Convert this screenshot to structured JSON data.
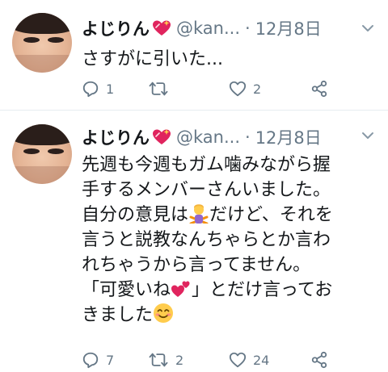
{
  "tweets": [
    {
      "display_name": "よじりん",
      "handle": "@kan...",
      "date": "12月8日",
      "separator": "·",
      "text_lines": [
        "さすがに引いた..."
      ],
      "counts": {
        "reply": "1",
        "retweet": "",
        "like": "2"
      }
    },
    {
      "display_name": "よじりん",
      "handle": "@kan...",
      "date": "12月8日",
      "separator": "·",
      "text_lines": [
        "先週も今週もガム噛みながら握",
        "手するメンバーさんいました。",
        [
          "自分の意見は",
          "だけど、それを"
        ],
        "言うと説教なんちゃらとか言わ",
        "れちゃうから言ってません。",
        [
          "「可愛いね",
          "」とだけ言ってお"
        ],
        [
          "きました",
          ""
        ]
      ],
      "counts": {
        "reply": "7",
        "retweet": "2",
        "like": "24"
      }
    }
  ],
  "icons": {
    "reply": "reply-icon",
    "retweet": "retweet-icon",
    "like": "like-icon",
    "share": "share-icon",
    "more": "chevron-down-icon",
    "badge": "sparkling-heart-emoji"
  },
  "colors": {
    "name": "#14171a",
    "meta": "#657786",
    "icon": "#657786",
    "badge": "#e0245e",
    "divider": "#e6ecf0"
  }
}
